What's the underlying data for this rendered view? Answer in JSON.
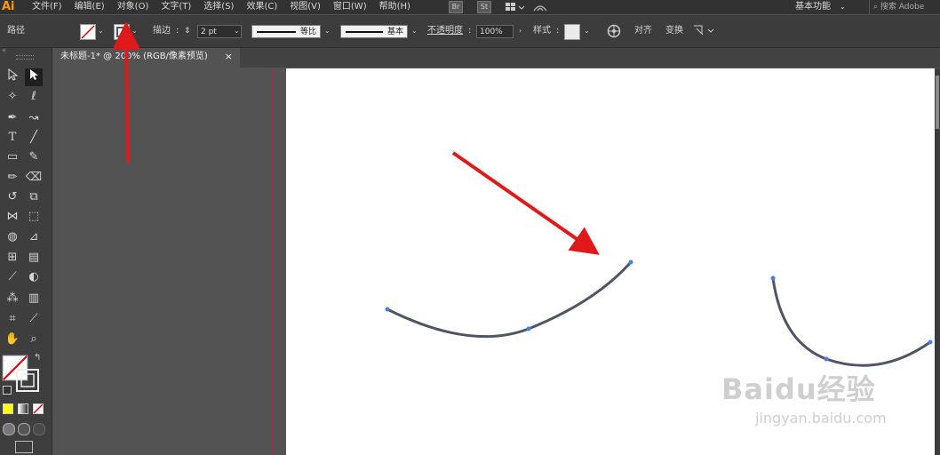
{
  "menubar": {
    "logo": "Ai",
    "items": [
      "文件(F)",
      "编辑(E)",
      "对象(O)",
      "文字(T)",
      "选择(S)",
      "效果(C)",
      "视图(V)",
      "窗口(W)",
      "帮助(H)"
    ],
    "badges": [
      "Br",
      "St"
    ],
    "workspace": "基本功能",
    "search_placeholder": "搜索 Adobe"
  },
  "control": {
    "selection": "路径",
    "stroke_label": "描边",
    "stroke_weight": "2 pt",
    "profile_label": "等比",
    "brush_label": "基本",
    "opacity_label": "不透明度",
    "opacity_value": "100%",
    "style_label": "样式",
    "align_label": "对齐",
    "transform_label": "变换"
  },
  "document": {
    "tab_title": "未标题-1* @ 200% (RGB/像素预览)",
    "close": "×"
  },
  "watermark": {
    "brand": "Baidu经验",
    "url": "jingyan.baidu.com"
  },
  "colors": {
    "menubar_bg": "#323232",
    "panel_bg": "#3c3c3c",
    "pasteboard": "#535353",
    "artboard": "#ffffff",
    "arrow": "#e01a1a",
    "path": "#505566",
    "anchor": "#4a7fe0",
    "logo": "#ff9a00"
  }
}
